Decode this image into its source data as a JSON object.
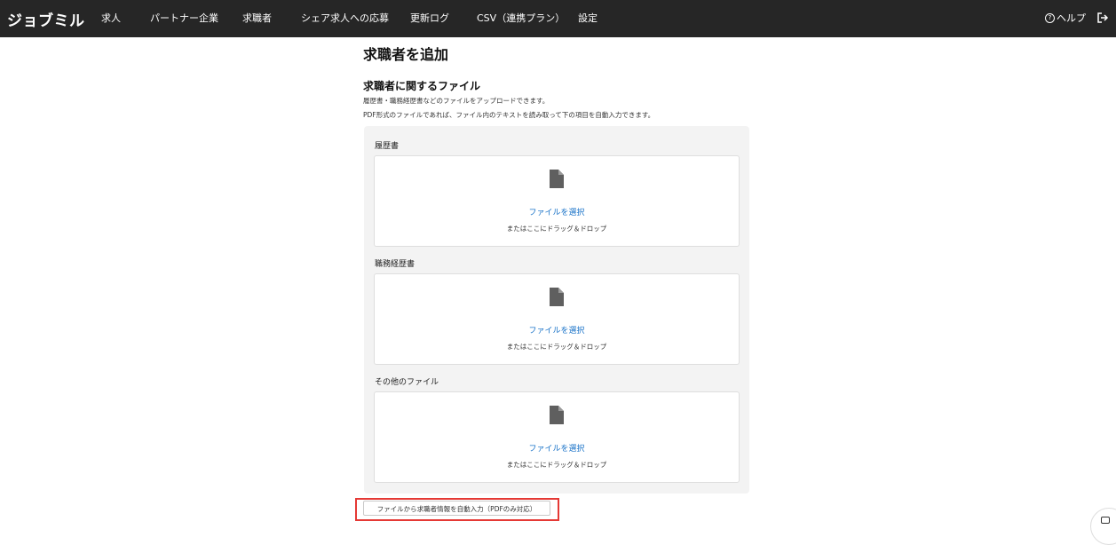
{
  "navbar": {
    "brand": "ジョブミル",
    "items": [
      "求人",
      "パートナー企業",
      "求職者",
      "シェア求人への応募",
      "更新ログ",
      "CSV（連携プラン）",
      "設定"
    ],
    "help_label": "ヘルプ",
    "help_icon": "question-circle-icon",
    "logout_icon": "logout-icon"
  },
  "page": {
    "title": "求職者を追加",
    "section_title": "求職者に関するファイル",
    "description_line1": "履歴書・職務経歴書などのファイルをアップロードできます。",
    "description_line2": "PDF形式のファイルであれば、ファイル内のテキストを読み取って下の項目を自動入力できます。"
  },
  "uploads": [
    {
      "label": "履歴書",
      "select_link": "ファイルを選択",
      "hint": "またはここにドラッグ＆ドロップ",
      "icon": "file-icon"
    },
    {
      "label": "職務経歴書",
      "select_link": "ファイルを選択",
      "hint": "またはここにドラッグ＆ドロップ",
      "icon": "file-icon"
    },
    {
      "label": "その他のファイル",
      "select_link": "ファイルを選択",
      "hint": "またはここにドラッグ＆ドロップ",
      "icon": "file-icon"
    }
  ],
  "auto_fill_button": "ファイルから求職者情報を自動入力（PDFのみ対応）",
  "colors": {
    "navbar_bg": "#262626",
    "link": "#1a73c8",
    "panel_bg": "#f3f3f3",
    "highlight": "#e53935"
  }
}
